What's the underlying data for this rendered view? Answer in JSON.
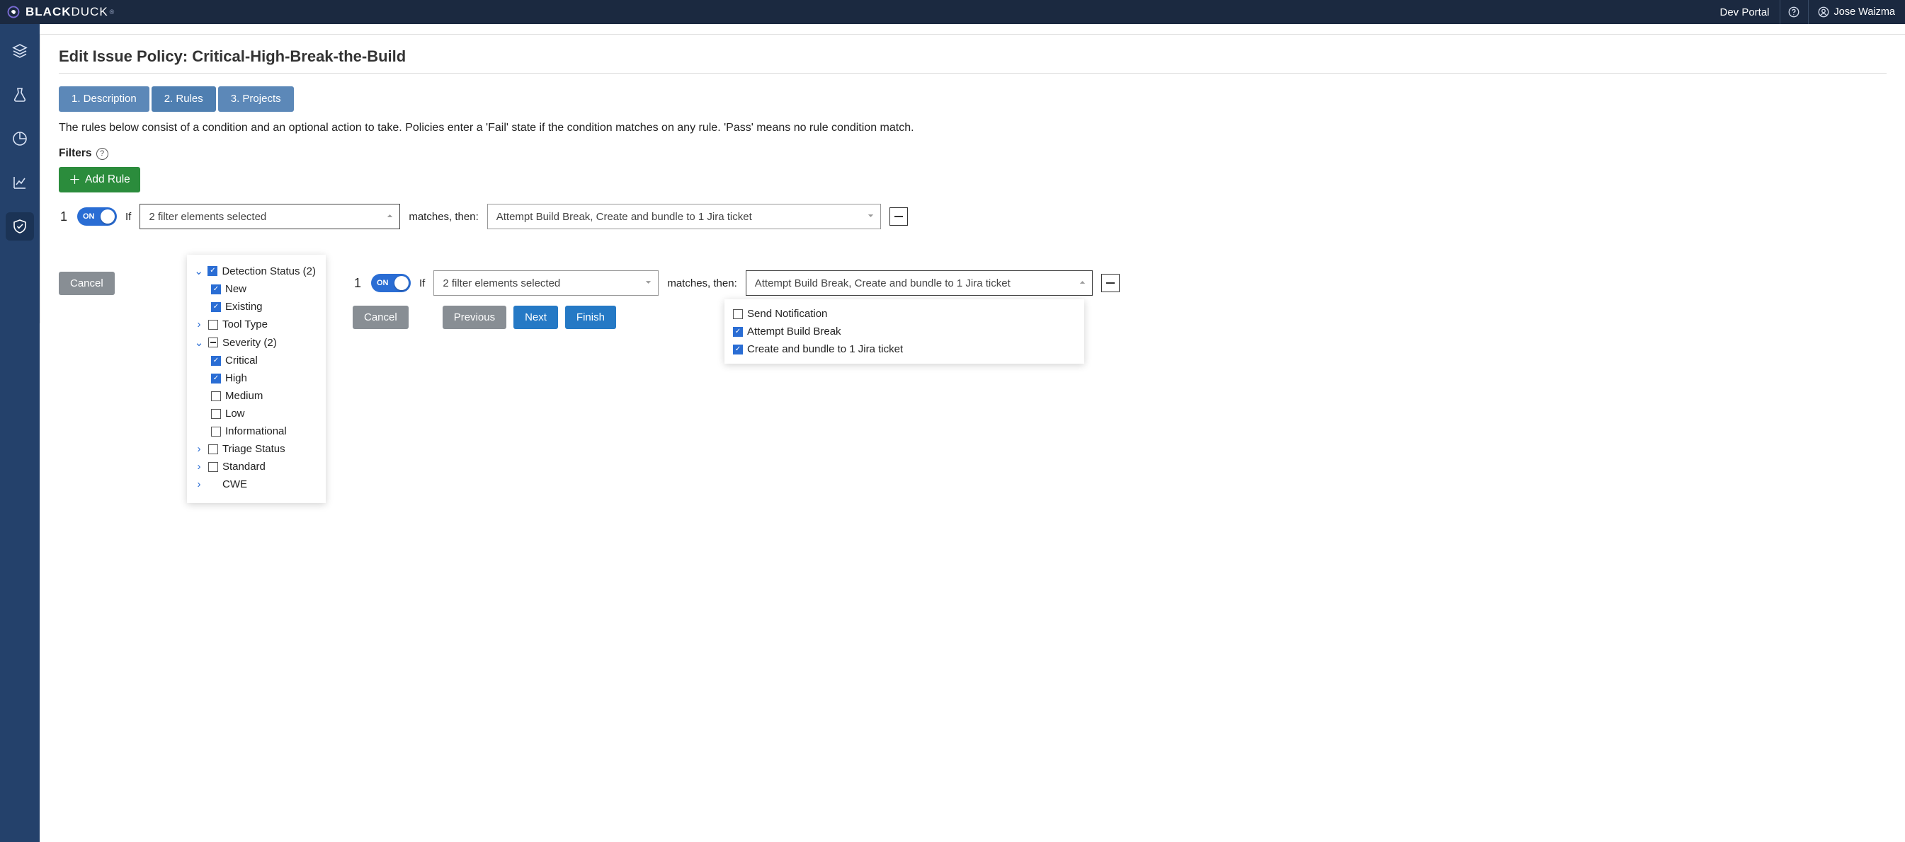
{
  "brand": {
    "bold": "BLACK",
    "thin": "DUCK"
  },
  "top": {
    "dev_portal": "Dev Portal",
    "user_name": "Jose Waizma"
  },
  "page": {
    "title": "Edit Issue Policy: Critical-High-Break-the-Build",
    "tabs": {
      "t1": "1. Description",
      "t2": "2. Rules",
      "t3": "3. Projects"
    },
    "description": "The rules below consist of a condition and an optional action to take. Policies enter a 'Fail' state if the condition matches on any rule. 'Pass' means no rule condition match.",
    "filters_label": "Filters",
    "add_rule": "Add Rule",
    "if": "If",
    "matches": "matches, then:",
    "rule_number": "1",
    "toggle_label": "ON",
    "filter_summary": "2 filter elements selected",
    "action_summary": "Attempt Build Break, Create and bundle to 1 Jira ticket"
  },
  "filters_dd": {
    "detection_status": "Detection Status (2)",
    "new": "New",
    "existing": "Existing",
    "tool_type": "Tool Type",
    "severity": "Severity (2)",
    "critical": "Critical",
    "high": "High",
    "medium": "Medium",
    "low": "Low",
    "informational": "Informational",
    "triage_status": "Triage Status",
    "standard": "Standard",
    "cwe": "CWE"
  },
  "actions_dd": {
    "send_notification": "Send Notification",
    "attempt_build_break": "Attempt Build Break",
    "create_jira": "Create and bundle to 1 Jira ticket"
  },
  "buttons": {
    "cancel": "Cancel",
    "previous": "Previous",
    "next": "Next",
    "finish": "Finish"
  },
  "overlay": {
    "rule_number": "1",
    "toggle_label": "ON",
    "if": "If",
    "filter_summary": "2 filter elements selected",
    "matches": "matches, then:",
    "action_summary": "Attempt Build Break, Create and bundle to 1 Jira ticket"
  }
}
